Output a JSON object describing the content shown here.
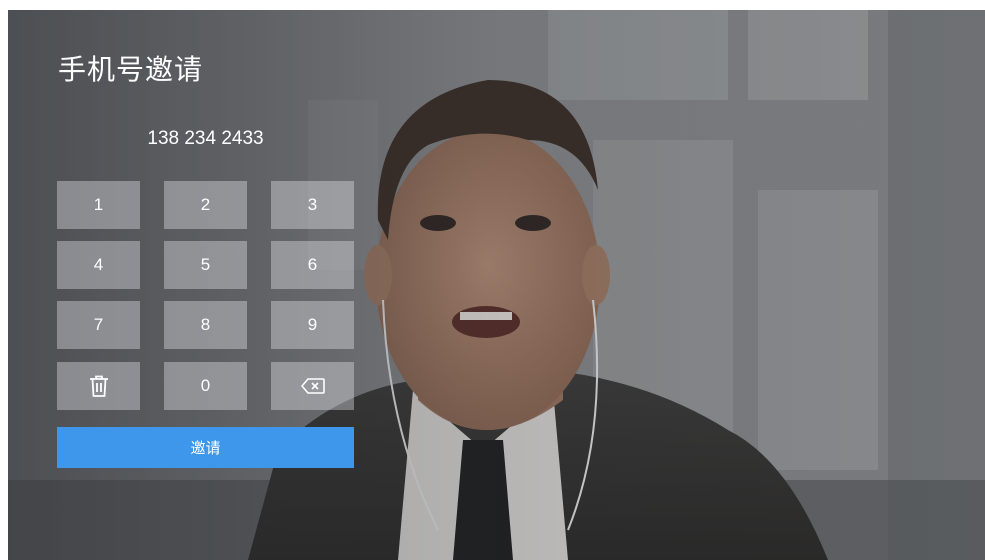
{
  "panel": {
    "title": "手机号邀请",
    "phone_number": "138 234 2433"
  },
  "keypad": {
    "keys": [
      "1",
      "2",
      "3",
      "4",
      "5",
      "6",
      "7",
      "8",
      "9",
      "0"
    ],
    "clear_icon": "trash-icon",
    "backspace_icon": "backspace-icon"
  },
  "actions": {
    "invite_label": "邀请"
  },
  "colors": {
    "primary": "#3e97ea",
    "key_background": "rgba(235,235,238,0.38)",
    "text": "#ffffff"
  }
}
